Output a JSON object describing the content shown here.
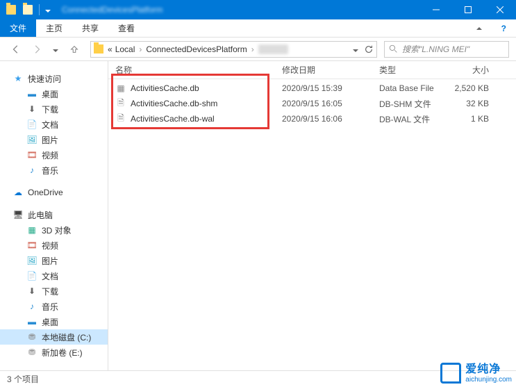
{
  "titlebar": {
    "title": "ConnectedDevicesPlatform"
  },
  "ribbon": {
    "file": "文件",
    "home": "主页",
    "share": "共享",
    "view": "查看"
  },
  "breadcrumb": {
    "local": "Local",
    "cdp": "ConnectedDevicesPlatform"
  },
  "search": {
    "placeholder": "搜索\"L.NING MEI\""
  },
  "columns": {
    "name": "名称",
    "modified": "修改日期",
    "type": "类型",
    "size": "大小"
  },
  "files": [
    {
      "name": "ActivitiesCache.db",
      "date": "2020/9/15 15:39",
      "type": "Data Base File",
      "size": "2,520 KB"
    },
    {
      "name": "ActivitiesCache.db-shm",
      "date": "2020/9/15 16:05",
      "type": "DB-SHM 文件",
      "size": "32 KB"
    },
    {
      "name": "ActivitiesCache.db-wal",
      "date": "2020/9/15 16:06",
      "type": "DB-WAL 文件",
      "size": "1 KB"
    }
  ],
  "sidebar": {
    "quick": "快速访问",
    "desktop": "桌面",
    "downloads": "下载",
    "documents": "文档",
    "pictures": "图片",
    "videos": "视频",
    "music": "音乐",
    "onedrive": "OneDrive",
    "thispc": "此电脑",
    "objects3d": "3D 对象",
    "videos2": "视频",
    "pictures2": "图片",
    "documents2": "文档",
    "downloads2": "下载",
    "music2": "音乐",
    "desktop2": "桌面",
    "localdisk": "本地磁盘 (C:)",
    "newvol": "新加卷 (E:)"
  },
  "status": "3 个项目",
  "watermark": {
    "cn": "爱纯净",
    "url": "aichunjing.com"
  }
}
